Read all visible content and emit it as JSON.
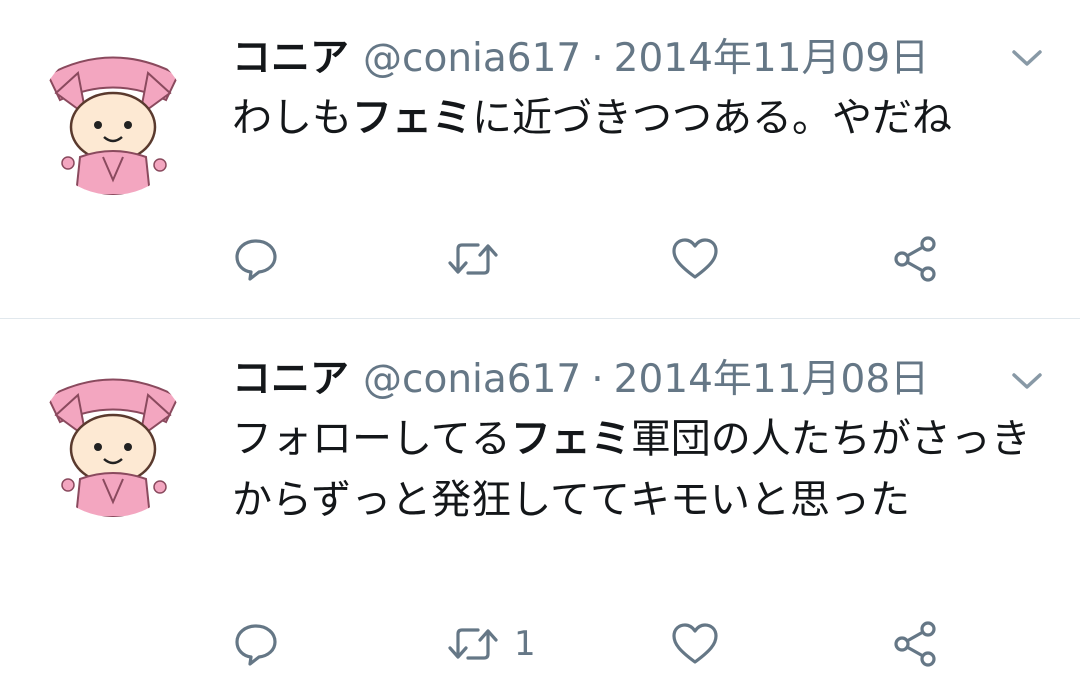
{
  "tweets": [
    {
      "name": "コニア",
      "handle": "@conia617",
      "separator": "·",
      "date": "2014年11月09日",
      "text_parts": [
        {
          "text": "わしも",
          "bold": false
        },
        {
          "text": "フェミ",
          "bold": true
        },
        {
          "text": "に近づきつつある。やだね",
          "bold": false
        }
      ],
      "actions": {
        "reply_icon": "reply-icon",
        "retweet_icon": "retweet-icon",
        "retweet_count": "",
        "like_icon": "heart-icon",
        "share_icon": "share-icon"
      }
    },
    {
      "name": "コニア",
      "handle": "@conia617",
      "separator": "·",
      "date": "2014年11月08日",
      "text_parts": [
        {
          "text": "フォローしてる",
          "bold": false
        },
        {
          "text": "フェミ",
          "bold": true
        },
        {
          "text": "軍団の人たちがさっきからずっと発狂しててキモいと思った",
          "bold": false
        }
      ],
      "actions": {
        "reply_icon": "reply-icon",
        "retweet_icon": "retweet-icon",
        "retweet_count": "1",
        "like_icon": "heart-icon",
        "share_icon": "share-icon"
      }
    }
  ],
  "colors": {
    "text": "#14171a",
    "secondary": "#657786",
    "divider": "#e1e8ed",
    "avatar_pink": "#f3a6c0"
  }
}
